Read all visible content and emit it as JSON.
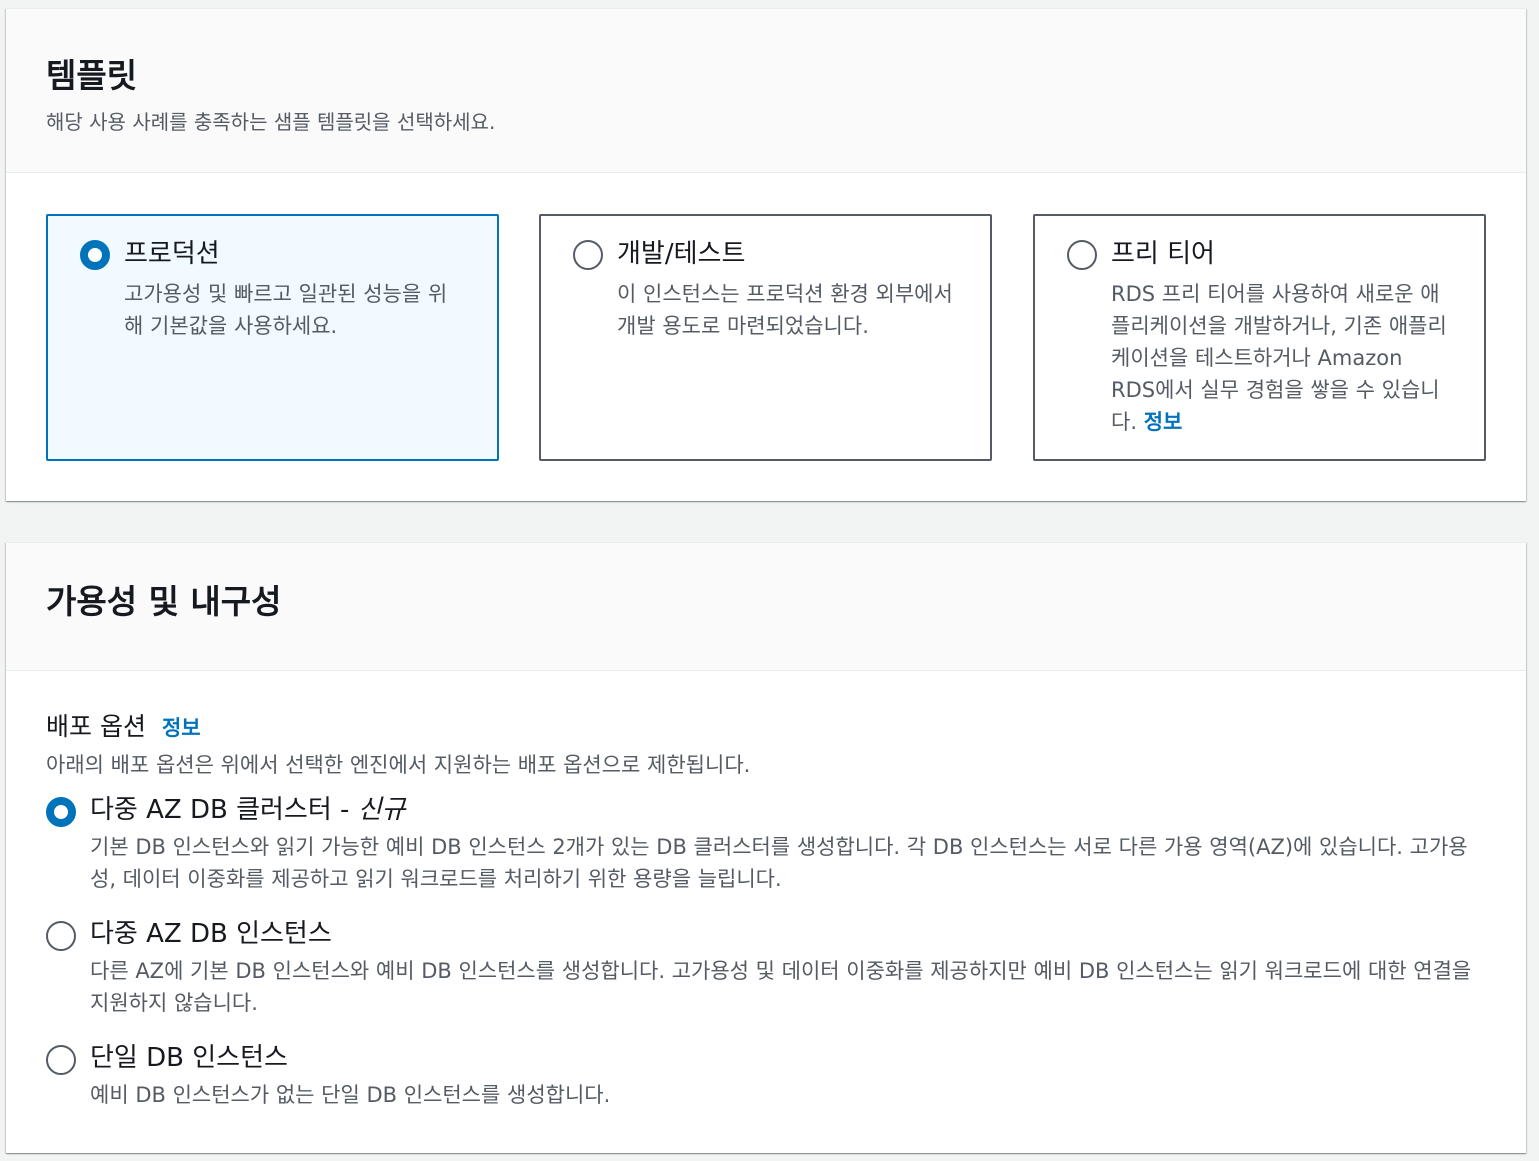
{
  "templates": {
    "title": "템플릿",
    "description": "해당 사용 사례를 충족하는 샘플 템플릿을 선택하세요.",
    "tiles": [
      {
        "label": "프로덕션",
        "description": "고가용성 및 빠르고 일관된 성능을 위해 기본값을 사용하세요.",
        "selected": true
      },
      {
        "label": "개발/테스트",
        "description": "이 인스턴스는 프로덕션 환경 외부에서 개발 용도로 마련되었습니다.",
        "selected": false
      },
      {
        "label": "프리 티어",
        "description": "RDS 프리 티어를 사용하여 새로운 애플리케이션을 개발하거나, 기존 애플리케이션을 테스트하거나 Amazon RDS에서 실무 경험을 쌓을 수 있습니다.",
        "info": "정보",
        "selected": false
      }
    ]
  },
  "availability": {
    "title": "가용성 및 내구성",
    "deployment": {
      "label": "배포 옵션",
      "info": "정보",
      "description": "아래의 배포 옵션은 위에서 선택한 엔진에서 지원하는 배포 옵션으로 제한됩니다.",
      "options": [
        {
          "label": "다중 AZ DB 클러스터 - ",
          "badge": "신규",
          "description": "기본 DB 인스턴스와 읽기 가능한 예비 DB 인스턴스 2개가 있는 DB 클러스터를 생성합니다. 각 DB 인스턴스는 서로 다른 가용 영역(AZ)에 있습니다. 고가용성, 데이터 이중화를 제공하고 읽기 워크로드를 처리하기 위한 용량을 늘립니다.",
          "selected": true
        },
        {
          "label": "다중 AZ DB 인스턴스",
          "description": "다른 AZ에 기본 DB 인스턴스와 예비 DB 인스턴스를 생성합니다. 고가용성 및 데이터 이중화를 제공하지만 예비 DB 인스턴스는 읽기 워크로드에 대한 연결을 지원하지 않습니다.",
          "selected": false
        },
        {
          "label": "단일 DB 인스턴스",
          "description": "예비 DB 인스턴스가 없는 단일 DB 인스턴스를 생성합니다.",
          "selected": false
        }
      ]
    }
  },
  "colors": {
    "accent": "#0073bb",
    "text": "#16191f",
    "muted": "#545b64",
    "selected_bg": "#f1faff"
  }
}
